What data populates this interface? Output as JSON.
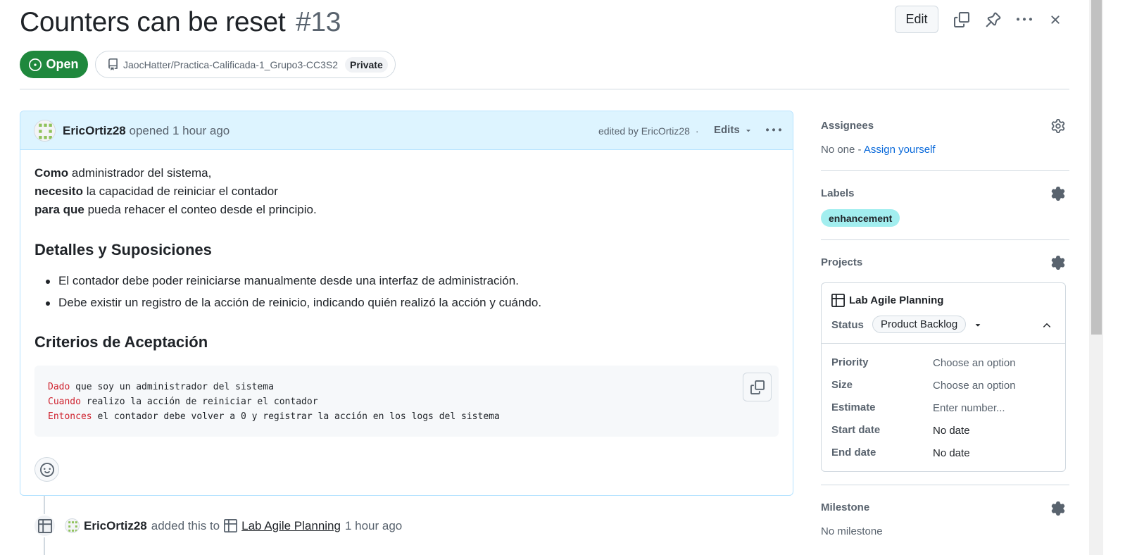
{
  "issue": {
    "title": "Counters can be reset",
    "number": "#13",
    "state": "Open",
    "repo": "JaocHatter/Practica-Calificada-1_Grupo3-CC3S2",
    "visibility": "Private"
  },
  "toolbar": {
    "edit_label": "Edit",
    "copy_icon": "copy-icon",
    "pin_icon": "pin-icon",
    "more_icon": "kebab-horizontal-icon",
    "close_icon": "x-icon"
  },
  "comment": {
    "author": "EricOrtiz28",
    "action": "opened",
    "time": "1 hour ago",
    "edited_prefix": "edited by",
    "edited_by": "EricOrtiz28",
    "separator": "·",
    "edits_label": "Edits",
    "story": [
      {
        "bold": "Como",
        "text": " administrador del sistema,"
      },
      {
        "bold": "necesito",
        "text": " la capacidad de reiniciar el contador"
      },
      {
        "bold": "para que",
        "text": " pueda rehacer el conteo desde el principio."
      }
    ],
    "section1_title": "Detalles y Suposiciones",
    "bullets": [
      "El contador debe poder reiniciarse manualmente desde una interfaz de administración.",
      "Debe existir un registro de la acción de reinicio, indicando quién realizó la acción y cuándo."
    ],
    "section2_title": "Criterios de Aceptación",
    "code_lines": [
      {
        "kw": "Dado",
        "text": " que soy un administrador del sistema"
      },
      {
        "kw": "Cuando",
        "text": " realizo la acción de reiniciar el contador"
      },
      {
        "kw": "Entonces",
        "text": " el contador debe volver a 0 y registrar la acción en los logs del sistema"
      }
    ]
  },
  "timeline": {
    "author": "EricOrtiz28",
    "action": "added this to",
    "project": "Lab Agile Planning",
    "time": "1 hour ago"
  },
  "sidebar": {
    "assignees": {
      "label": "Assignees",
      "value_prefix": "No one -",
      "value_link": "Assign yourself"
    },
    "labels": {
      "label": "Labels",
      "items": [
        "enhancement"
      ],
      "chip_color": "#a2eeef"
    },
    "projects": {
      "label": "Projects",
      "project_name": "Lab Agile Planning",
      "status_label": "Status",
      "status_value": "Product Backlog",
      "fields": [
        {
          "name": "Priority",
          "value": "Choose an option"
        },
        {
          "name": "Size",
          "value": "Choose an option"
        },
        {
          "name": "Estimate",
          "value": "Enter number..."
        },
        {
          "name": "Start date",
          "value": "No date"
        },
        {
          "name": "End date",
          "value": "No date"
        }
      ]
    },
    "milestone": {
      "label": "Milestone",
      "value": "No milestone"
    }
  },
  "colors": {
    "open_green": "#1f883d",
    "comment_header_blue": "#ddf4ff",
    "link_blue": "#0969da",
    "code_keyword_red": "#cf222e"
  }
}
